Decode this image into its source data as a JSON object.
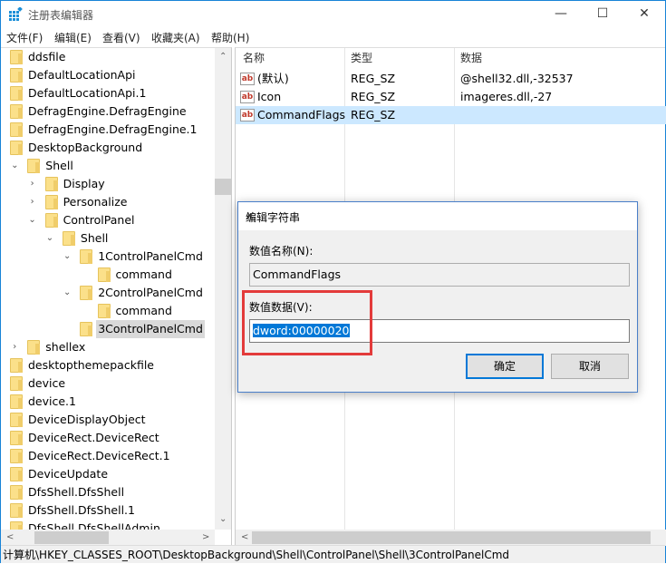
{
  "window": {
    "title": "注册表编辑器",
    "minimize": "—",
    "maximize": "☐",
    "close": "✕"
  },
  "menu": [
    "文件(F)",
    "编辑(E)",
    "查看(V)",
    "收藏夹(A)",
    "帮助(H)"
  ],
  "tree": [
    {
      "label": "ddsfile",
      "level": 0,
      "exp": ""
    },
    {
      "label": "DefaultLocationApi",
      "level": 0,
      "exp": ""
    },
    {
      "label": "DefaultLocationApi.1",
      "level": 0,
      "exp": ""
    },
    {
      "label": "DefragEngine.DefragEngine",
      "level": 0,
      "exp": ""
    },
    {
      "label": "DefragEngine.DefragEngine.1",
      "level": 0,
      "exp": ""
    },
    {
      "label": "DesktopBackground",
      "level": 0,
      "exp": ""
    },
    {
      "label": "Shell",
      "level": 1,
      "exp": "open"
    },
    {
      "label": "Display",
      "level": 2,
      "exp": "closed"
    },
    {
      "label": "Personalize",
      "level": 2,
      "exp": "closed"
    },
    {
      "label": "ControlPanel",
      "level": 2,
      "exp": "open"
    },
    {
      "label": "Shell",
      "level": 3,
      "exp": "open"
    },
    {
      "label": "1ControlPanelCmd",
      "level": 4,
      "exp": "open"
    },
    {
      "label": "command",
      "level": 5,
      "exp": ""
    },
    {
      "label": "2ControlPanelCmd",
      "level": 4,
      "exp": "open"
    },
    {
      "label": "command",
      "level": 5,
      "exp": ""
    },
    {
      "label": "3ControlPanelCmd",
      "level": 4,
      "exp": "",
      "selected": true
    },
    {
      "label": "shellex",
      "level": 1,
      "exp": "closed"
    },
    {
      "label": "desktopthemepackfile",
      "level": 0,
      "exp": ""
    },
    {
      "label": "device",
      "level": 0,
      "exp": ""
    },
    {
      "label": "device.1",
      "level": 0,
      "exp": ""
    },
    {
      "label": "DeviceDisplayObject",
      "level": 0,
      "exp": ""
    },
    {
      "label": "DeviceRect.DeviceRect",
      "level": 0,
      "exp": ""
    },
    {
      "label": "DeviceRect.DeviceRect.1",
      "level": 0,
      "exp": ""
    },
    {
      "label": "DeviceUpdate",
      "level": 0,
      "exp": ""
    },
    {
      "label": "DfsShell.DfsShell",
      "level": 0,
      "exp": ""
    },
    {
      "label": "DfsShell.DfsShell.1",
      "level": 0,
      "exp": ""
    },
    {
      "label": "DfsShell.DfsShellAdmin",
      "level": 0,
      "exp": ""
    }
  ],
  "list": {
    "columns": [
      "名称",
      "类型",
      "数据"
    ],
    "rows": [
      {
        "name": "(默认)",
        "type": "REG_SZ",
        "data": "@shell32.dll,-32537"
      },
      {
        "name": "Icon",
        "type": "REG_SZ",
        "data": "imageres.dll,-27"
      },
      {
        "name": "CommandFlags",
        "type": "REG_SZ",
        "data": "",
        "selected": true
      }
    ],
    "value_icon": "ab"
  },
  "status": "计算机\\HKEY_CLASSES_ROOT\\DesktopBackground\\Shell\\ControlPanel\\Shell\\3ControlPanelCmd",
  "dialog": {
    "title": "编辑字符串",
    "name_label": "数值名称(N):",
    "name_value": "CommandFlags",
    "data_label": "数值数据(V):",
    "data_value": "dword:00000020",
    "ok": "确定",
    "cancel": "取消"
  },
  "colors": {
    "selection": "#cce8ff",
    "highlight": "#0078d7",
    "annotation": "#e33b3b"
  }
}
